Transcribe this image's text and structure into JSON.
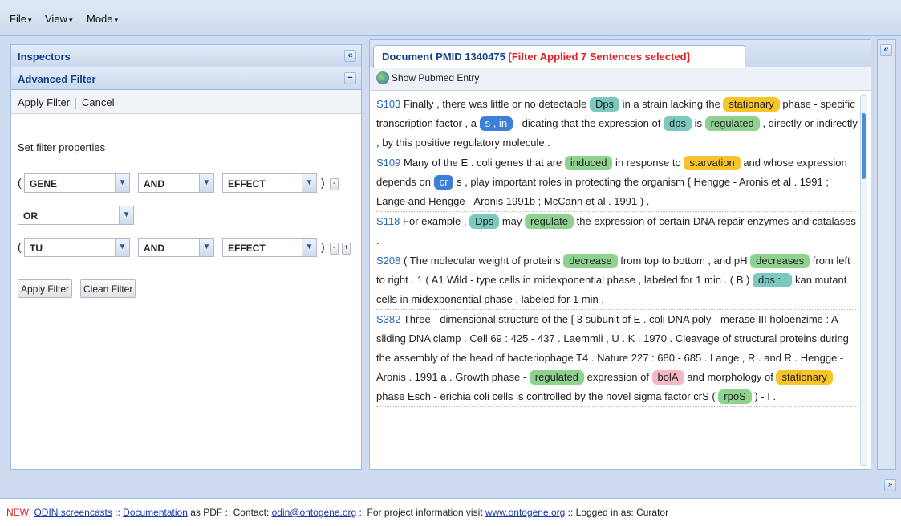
{
  "menubar": {
    "items": [
      "File",
      "View",
      "Mode"
    ]
  },
  "left": {
    "title": "Inspectors",
    "collapse_icon": "«",
    "filter_title": "Advanced Filter",
    "minimize_icon": "−",
    "toolbar": {
      "apply": "Apply Filter",
      "cancel": "Cancel"
    },
    "set_props": "Set filter properties",
    "row1": {
      "open": "(",
      "field": "GENE",
      "op": "AND",
      "target": "EFFECT",
      "close": ")",
      "minus": "-"
    },
    "middle_op": "OR",
    "row2": {
      "open": "(",
      "field": "TU",
      "op": "AND",
      "target": "EFFECT",
      "close": ")",
      "minus": "-",
      "plus": "+"
    },
    "buttons": {
      "apply": "Apply Filter",
      "clean": "Clean Filter"
    }
  },
  "document": {
    "tab_title": "Document PMID 1340475",
    "tab_filter": "[Filter Applied 7 Sentences selected]",
    "pubmed": "Show Pubmed Entry",
    "sentences": [
      {
        "id": "S103",
        "parts": [
          {
            "t": " Finally , there was little or no detectable "
          },
          {
            "t": "Dps",
            "c": "teal"
          },
          {
            "t": " in a strain lacking the "
          },
          {
            "t": "stationary",
            "c": "orange"
          },
          {
            "t": " phase - specific transcription factor , a "
          },
          {
            "t": "s , in",
            "c": "blue"
          },
          {
            "t": " - dicating that the expression of "
          },
          {
            "t": "dps",
            "c": "teal"
          },
          {
            "t": " is "
          },
          {
            "t": "regulated",
            "c": "green"
          },
          {
            "t": " , directly or indirectly , by this positive regulatory molecule ."
          }
        ]
      },
      {
        "id": "S109",
        "parts": [
          {
            "t": " Many of the E . coli genes that are "
          },
          {
            "t": "induced",
            "c": "green"
          },
          {
            "t": " in response to "
          },
          {
            "t": "starvation",
            "c": "orange"
          },
          {
            "t": " and whose expression depends on "
          },
          {
            "t": "cr",
            "c": "blue"
          },
          {
            "t": " s , play important roles in protecting the organism { Hengge - Aronis et al . 1991 ; Lange and Hengge - Aronis 1991b ; McCann et al . 1991 ) ."
          }
        ]
      },
      {
        "id": "S118",
        "parts": [
          {
            "t": " For example , "
          },
          {
            "t": "Dps",
            "c": "teal"
          },
          {
            "t": " may "
          },
          {
            "t": "regulate",
            "c": "green"
          },
          {
            "t": " the expression of certain DNA repair enzymes and catalases ."
          }
        ]
      },
      {
        "id": "S208",
        "parts": [
          {
            "t": " ( The molecular weight of proteins "
          },
          {
            "t": "decrease",
            "c": "green"
          },
          {
            "t": " from top to bottom , and pH "
          },
          {
            "t": "decreases",
            "c": "green"
          },
          {
            "t": " from left to right . 1 ( A1 Wild - type cells in midexponential phase , labeled for 1 min . ( B ) "
          },
          {
            "t": "dps : :",
            "c": "teal"
          },
          {
            "t": " kan mutant cells in midexponential phase , labeled for 1 min ."
          }
        ]
      },
      {
        "id": "S382",
        "parts": [
          {
            "t": " Three - dimensional structure of the [ 3 subunit of E . coli DNA poly - merase III holoenzime : A sliding DNA clamp . Cell 69 : 425 - 437 . Laemmli , U . K . 1970 . Cleavage of structural proteins during the assembly of the head of bacteriophage T4 . Nature 227 : 680 - 685 . Lange , R . and R . Hengge - Aronis . 1991 a . Growth phase - "
          },
          {
            "t": "regulated",
            "c": "green"
          },
          {
            "t": " expression of "
          },
          {
            "t": "bolA",
            "c": "pink"
          },
          {
            "t": " and morphology of "
          },
          {
            "t": "stationary",
            "c": "orange"
          },
          {
            "t": " phase Esch - erichia coli cells is controlled by the novel sigma factor crS ( "
          },
          {
            "t": "rpoS",
            "c": "green"
          },
          {
            "t": " ) - I ."
          }
        ]
      }
    ]
  },
  "right": {
    "collapse_icon": "«"
  },
  "bottom_collapse_icon": "»",
  "status": {
    "new": "NEW:",
    "screencasts": "ODIN screencasts",
    "sep1": " :: ",
    "documentation": "Documentation",
    "as_pdf": " as PDF :: Contact: ",
    "email": "odin@ontogene.org",
    "project_text": " ::  For project information visit ",
    "website": "www.ontogene.org",
    "logged_in": " :: Logged in as: Curator"
  },
  "colors": {
    "accent": "#15428b",
    "filter_red": "#e02020",
    "link": "#1a3ca8",
    "tag_green": "#8fd28f",
    "tag_orange": "#f9c32a",
    "tag_blue": "#3b7fd9",
    "tag_pink": "#f4b8c4",
    "tag_teal": "#7cc9c0"
  }
}
